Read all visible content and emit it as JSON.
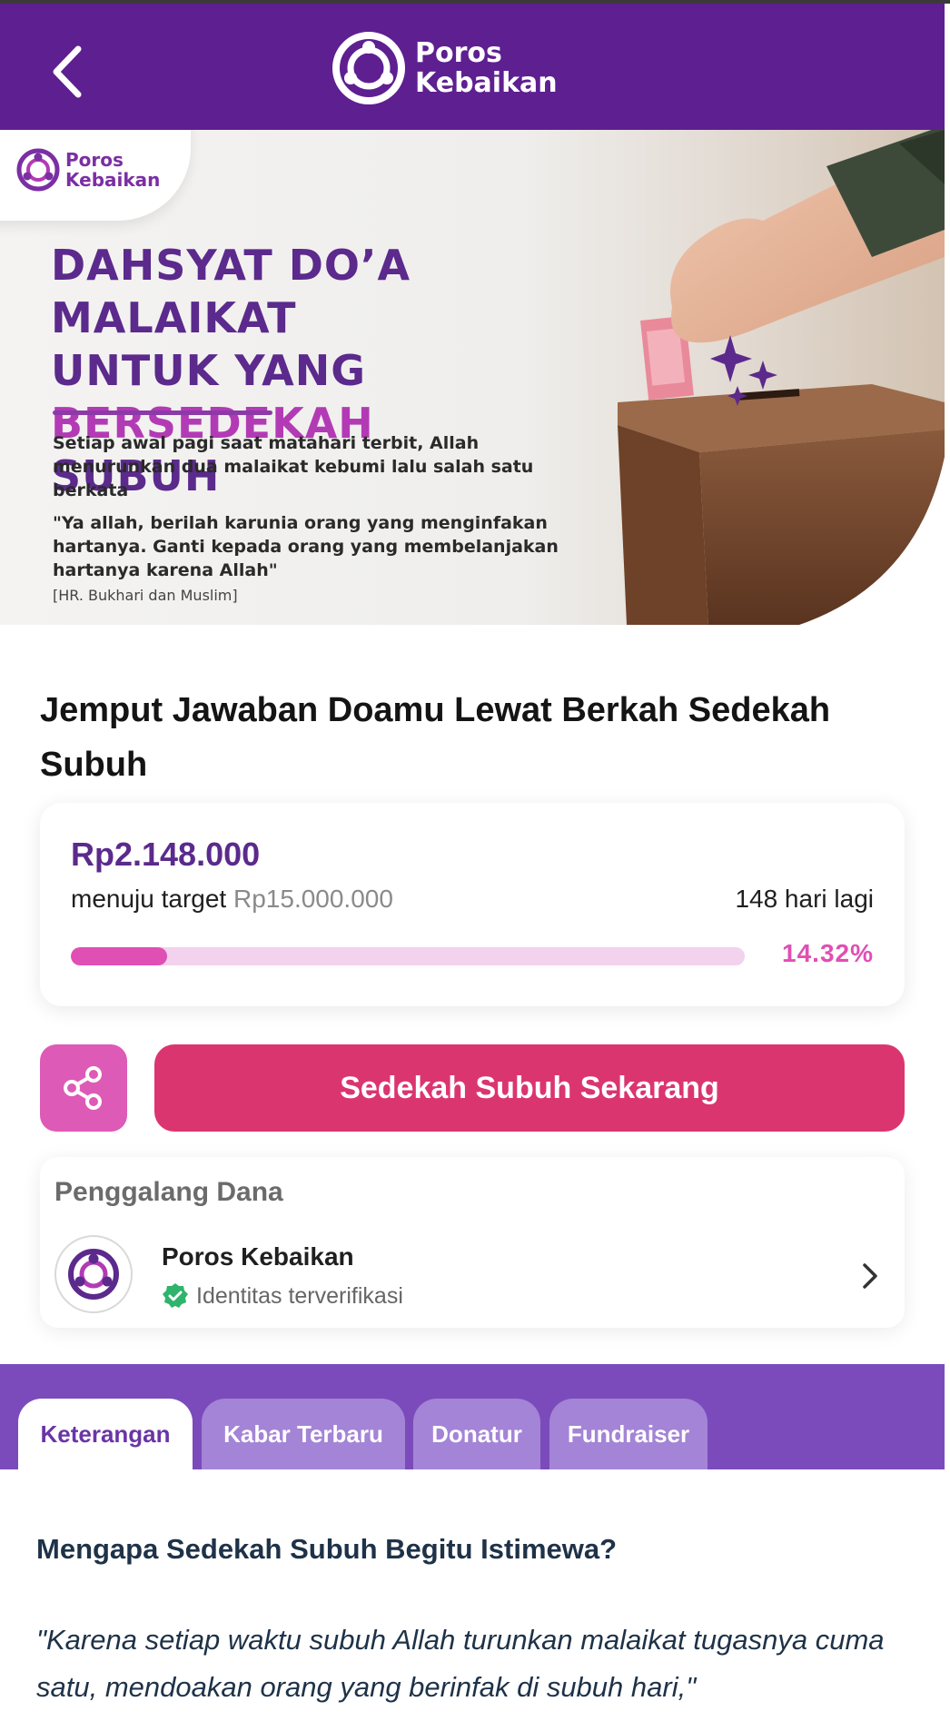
{
  "app": {
    "brand_line1": "Poros",
    "brand_line2": "Kebaikan",
    "accent_color": "#5e1f91",
    "pink_color": "#db3570"
  },
  "header": {
    "back_icon": "chevron-left-icon"
  },
  "banner": {
    "badge_line1": "Poros",
    "badge_line2": "Kebaikan",
    "title_line1": "DAHSYAT DO’A MALAIKAT",
    "title_line2a": "UNTUK YANG ",
    "title_line2b": "BERSEDEKAH",
    "title_line3": "SUBUH",
    "body": "Setiap awal pagi saat matahari terbit, Allah menurunkan dua malaikat kebumi lalu salah satu berkata",
    "quote": "\"Ya allah, berilah karunia orang yang menginfakan hartanya. Ganti kepada orang yang membelanjakan hartanya karena Allah\"",
    "source": "[HR. Bukhari dan Muslim]"
  },
  "campaign": {
    "title": "Jemput Jawaban Doamu Lewat Berkah Sedekah Subuh",
    "raised": "Rp2.148.000",
    "target_prefix": "menuju target ",
    "target_amount": "Rp15.000.000",
    "days_left": "148 hari lagi",
    "progress_percent_label": "14.32%",
    "progress_fraction": 0.1432
  },
  "actions": {
    "share_icon": "share-icon",
    "donate_label": "Sedekah Subuh Sekarang"
  },
  "fundraiser": {
    "heading": "Penggalang Dana",
    "name": "Poros Kebaikan",
    "verified_label": "Identitas terverifikasi"
  },
  "tabs": [
    {
      "label": "Keterangan",
      "active": true
    },
    {
      "label": "Kabar Terbaru",
      "active": false
    },
    {
      "label": "Donatur",
      "active": false
    },
    {
      "label": "Fundraiser",
      "active": false
    }
  ],
  "description": {
    "heading": "Mengapa Sedekah Subuh Begitu Istimewa?",
    "quote": "\"Karena setiap waktu subuh Allah turunkan malaikat tugasnya cuma satu, mendoakan orang yang berinfak di subuh hari,\""
  }
}
